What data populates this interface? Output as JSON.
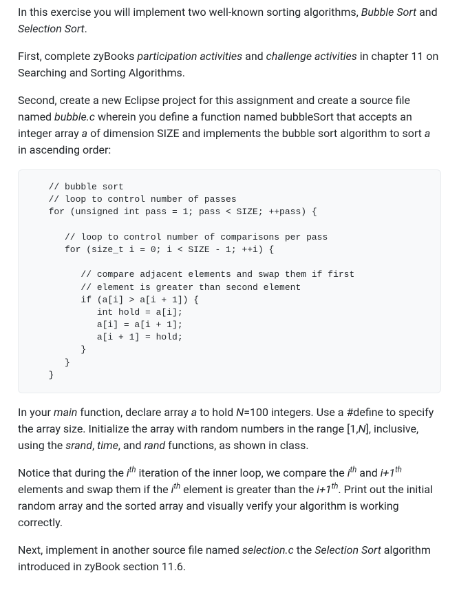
{
  "para1": {
    "t1": "In this exercise you will implement two well-known sorting algorithms, ",
    "bs": "Bubble Sort",
    "t2": " and ",
    "ss": "Selection Sort",
    "t3": "."
  },
  "para2": {
    "t1": "First, complete zyBooks ",
    "pa": "participation activities",
    "t2": " and ",
    "ca": "challenge activities",
    "t3": " in chapter 11 on Searching and Sorting Algorithms."
  },
  "para3": {
    "t1": "Second, create a new Eclipse project for this assignment and create a source file named ",
    "bc": "bubble.c",
    "t2": " wherein you define a function named bubbleSort that accepts an integer array ",
    "a": "a",
    "t3": " of dimension SIZE and implements the bubble sort algorithm to sort ",
    "a2": "a",
    "t4": " in ascending order:"
  },
  "code": "  // bubble sort\n  // loop to control number of passes\n  for (unsigned int pass = 1; pass < SIZE; ++pass) {\n\n     // loop to control number of comparisons per pass\n     for (size_t i = 0; i < SIZE - 1; ++i) {\n\n        // compare adjacent elements and swap them if first\n        // element is greater than second element\n        if (a[i] > a[i + 1]) {\n           int hold = a[i];\n           a[i] = a[i + 1];\n           a[i + 1] = hold;\n        }\n     }\n  }",
  "para4": {
    "t1": "In your ",
    "main": "main",
    "t2": " function, declare array ",
    "a": "a",
    "t3": " to hold ",
    "n": "N",
    "t4": "=100 integers.  Use a #define to specify the array size.  Initialize the array with random numbers in the range [1,",
    "n2": "N",
    "t5": "], inclusive, using the ",
    "srand": "srand",
    "c1": ", ",
    "time": "time",
    "c2": ", and ",
    "rand": "rand",
    "t6": " functions, as shown in class."
  },
  "para5": {
    "t1": "Notice that during the ",
    "i1": "i",
    "sup_th": "th",
    "t2": " iteration of the inner loop, we compare the ",
    "i2": "i",
    "t3": " and ",
    "ip1": "i+1",
    "t4": " elements and swap them if the ",
    "i3": "i",
    "t5": " element is greater than the ",
    "ip1b": "i+1",
    "t6": ".  Print out the initial random array and the sorted array and visually verify your algorithm is working correctly."
  },
  "para6": {
    "t1": "Next, implement in another source file named ",
    "sc": "selection.c",
    "t2": " the ",
    "ss": "Selection Sort",
    "t3": " algorithm introduced in zyBook section 11.6."
  }
}
